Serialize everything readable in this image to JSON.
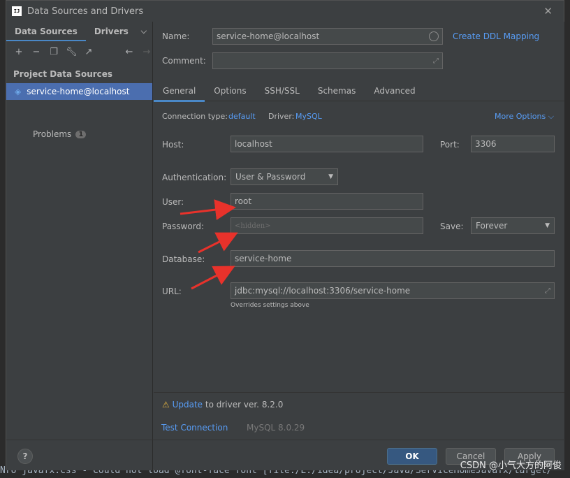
{
  "window": {
    "title": "Data Sources and Drivers"
  },
  "left": {
    "tabs": [
      "Data Sources",
      "Drivers"
    ],
    "section_header": "Project Data Sources",
    "selected_item": "service-home@localhost",
    "problems_label": "Problems",
    "problems_count": "1"
  },
  "form": {
    "name_label": "Name:",
    "name_value": "service-home@localhost",
    "create_ddl": "Create DDL Mapping",
    "comment_label": "Comment:",
    "comment_value": "",
    "tabs": [
      "General",
      "Options",
      "SSH/SSL",
      "Schemas",
      "Advanced"
    ],
    "connection_type_label": "Connection type:",
    "connection_type_value": "default",
    "driver_label": "Driver:",
    "driver_value": "MySQL",
    "more_options": "More Options",
    "host_label": "Host:",
    "host_value": "localhost",
    "port_label": "Port:",
    "port_value": "3306",
    "auth_label": "Authentication:",
    "auth_value": "User & Password",
    "user_label": "User:",
    "user_value": "root",
    "password_label": "Password:",
    "password_placeholder": "<hidden>",
    "save_label": "Save:",
    "save_value": "Forever",
    "database_label": "Database:",
    "database_value": "service-home",
    "url_label": "URL:",
    "url_value": "jdbc:mysql://localhost:3306/service-home",
    "url_hint": "Overrides settings above",
    "update_link": "Update",
    "update_text": "to driver ver. 8.2.0",
    "test_connection": "Test Connection",
    "mysql_version": "MySQL 8.0.29"
  },
  "buttons": {
    "ok": "OK",
    "cancel": "Cancel",
    "apply": "Apply",
    "help": "?"
  },
  "background": {
    "bottom_line": "Nro  javafx.css - Could not load @font-face font [file:/E:/idea/project/Java/ServiceHomeJavafx/target/"
  },
  "watermark": "CSDN @小气大方的阿俊",
  "colors": {
    "accent": "#589df6",
    "selection": "#4b6eaf",
    "arrow": "#e8322b"
  }
}
